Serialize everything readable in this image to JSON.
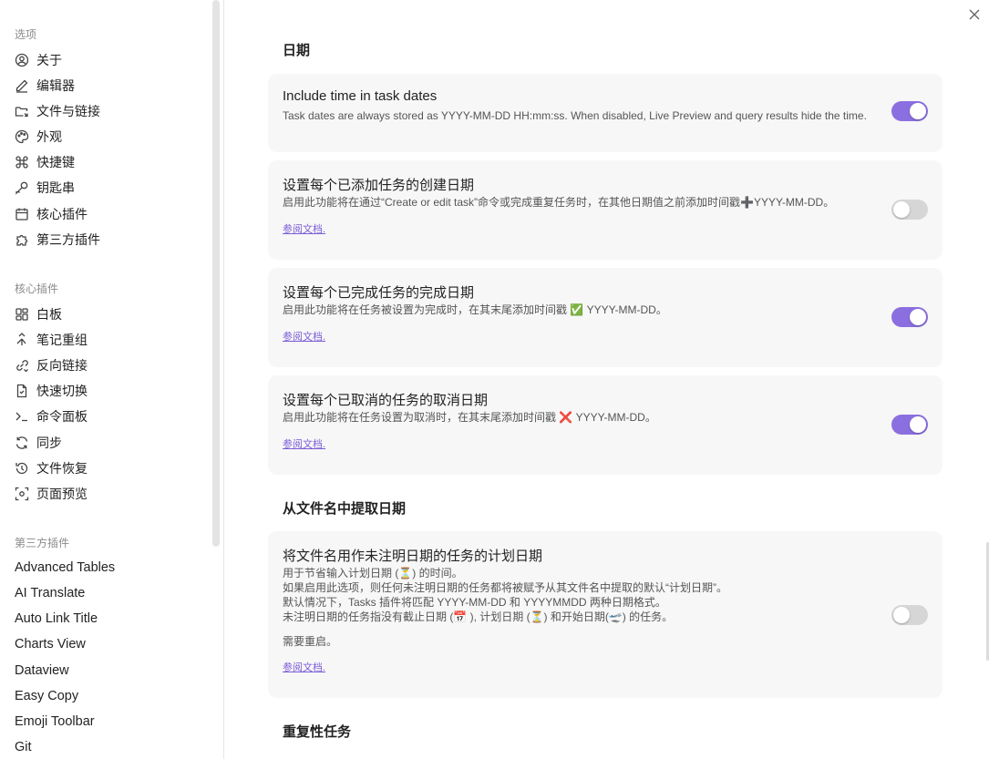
{
  "sidebar": {
    "section_options": "选项",
    "options": [
      {
        "label": "关于",
        "icon": "user-circle-icon"
      },
      {
        "label": "编辑器",
        "icon": "pen-icon"
      },
      {
        "label": "文件与链接",
        "icon": "folder-link-icon"
      },
      {
        "label": "外观",
        "icon": "palette-icon"
      },
      {
        "label": "快捷键",
        "icon": "command-icon"
      },
      {
        "label": "钥匙串",
        "icon": "key-icon"
      },
      {
        "label": "核心插件",
        "icon": "calendar-plugin-icon"
      },
      {
        "label": "第三方插件",
        "icon": "puzzle-icon"
      }
    ],
    "section_core": "核心插件",
    "core": [
      {
        "label": "白板",
        "icon": "canvas-icon"
      },
      {
        "label": "笔记重组",
        "icon": "merge-icon"
      },
      {
        "label": "反向链接",
        "icon": "backlink-icon"
      },
      {
        "label": "快速切换",
        "icon": "file-switch-icon"
      },
      {
        "label": "命令面板",
        "icon": "terminal-icon"
      },
      {
        "label": "同步",
        "icon": "sync-icon"
      },
      {
        "label": "文件恢复",
        "icon": "history-icon"
      },
      {
        "label": "页面预览",
        "icon": "preview-icon"
      }
    ],
    "section_third": "第三方插件",
    "third": [
      "Advanced Tables",
      "AI Translate",
      "Auto Link Title",
      "Charts View",
      "Dataview",
      "Easy Copy",
      "Emoji Toolbar",
      "Git"
    ]
  },
  "main": {
    "heading_dates": "日期",
    "cards": [
      {
        "title": "Include time in task dates",
        "desc": "Task dates are always stored as YYYY-MM-DD HH:mm:ss. When disabled, Live Preview and query results hide the time.",
        "toggle": "on"
      },
      {
        "title": "设置每个已添加任务的创建日期",
        "desc": "启用此功能将在通过“Create or edit task”命令或完成重复任务时，在其他日期值之前添加时间戳➕YYYY-MM-DD。",
        "link": "参阅文档.",
        "toggle": "off"
      },
      {
        "title": "设置每个已完成任务的完成日期",
        "desc": "启用此功能将在任务被设置为完成时，在其末尾添加时间戳 ✅ YYYY-MM-DD。",
        "link": "参阅文档.",
        "toggle": "on"
      },
      {
        "title": "设置每个已取消的任务的取消日期",
        "desc": "启用此功能将在任务设置为取消时，在其末尾添加时间戳 ❌ YYYY-MM-DD。",
        "link": "参阅文档.",
        "toggle": "on"
      }
    ],
    "heading_filename": "从文件名中提取日期",
    "filename_card": {
      "title": "将文件名用作未注明日期的任务的计划日期",
      "lines": [
        "用于节省输入计划日期 (⏳) 的时间。",
        "如果启用此选项，则任何未注明日期的任务都将被赋予从其文件名中提取的默认“计划日期”。",
        "默认情况下，Tasks 插件将匹配 YYYY-MM-DD 和 YYYYMMDD 两种日期格式。",
        "未注明日期的任务指没有截止日期 (📅 ), 计划日期 (⏳) 和开始日期(🛫) 的任务。"
      ],
      "restart": "需要重启。",
      "link": "参阅文档.",
      "toggle": "off"
    },
    "heading_recurring": "重复性任务"
  }
}
